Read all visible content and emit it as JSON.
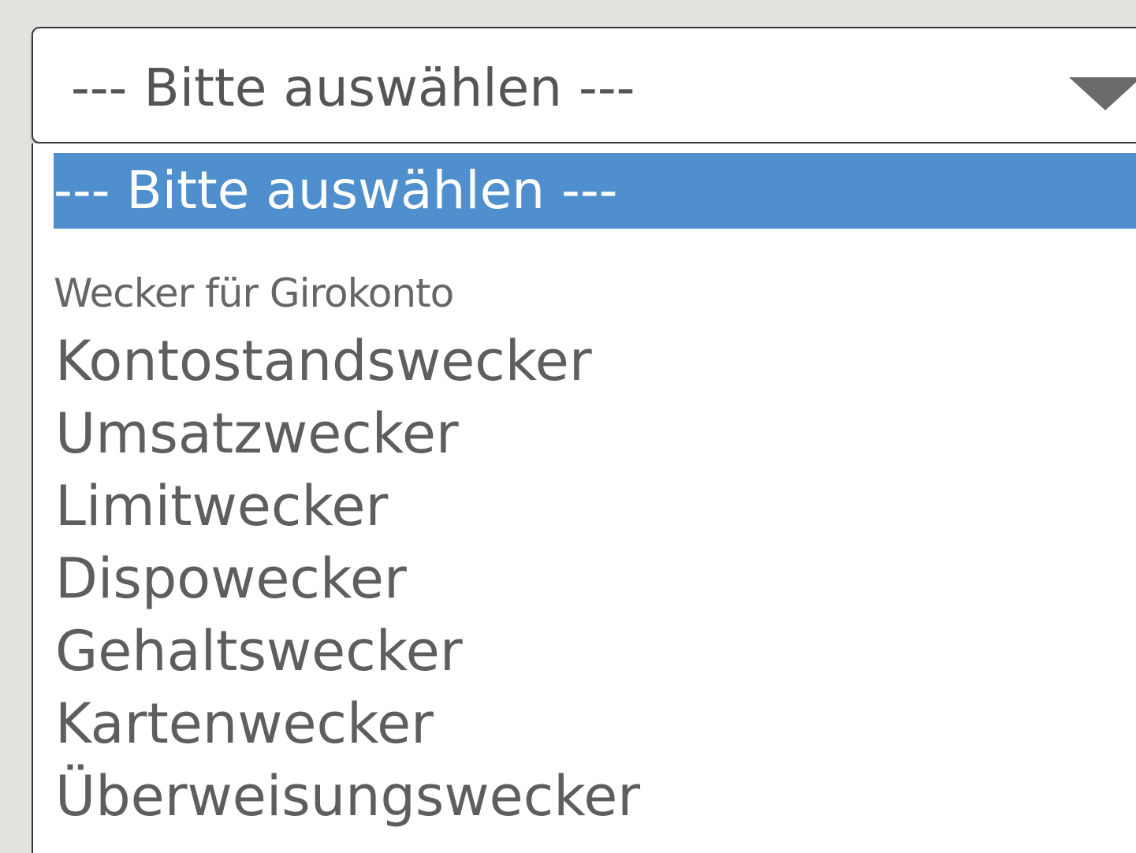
{
  "select": {
    "current_value": "--- Bitte auswählen ---"
  },
  "dropdown": {
    "selected_option": "--- Bitte auswählen ---",
    "group_label": "Wecker für Girokonto",
    "options": [
      "Kontostandswecker",
      "Umsatzwecker",
      "Limitwecker",
      "Dispowecker",
      "Gehaltswecker",
      "Kartenwecker",
      "Überweisungswecker"
    ]
  },
  "icons": {
    "arrow": "chevron-down-icon"
  },
  "colors": {
    "highlight": "#4f8fcd",
    "text": "#5e5e5e",
    "background": "#e3e2de"
  }
}
